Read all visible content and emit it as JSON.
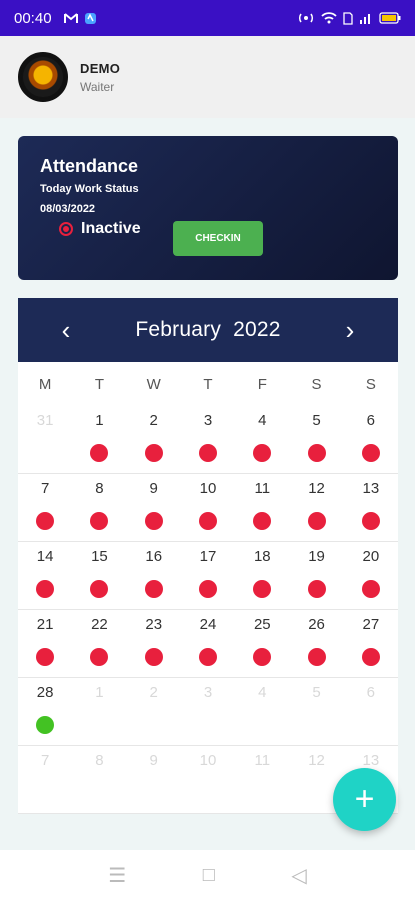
{
  "status_bar": {
    "time": "00:40",
    "left_icons": [
      "gmail-icon",
      "app-icon"
    ],
    "right_icons": [
      "hotspot-icon",
      "wifi-icon",
      "sim-icon",
      "signal-icon",
      "battery-icon"
    ]
  },
  "profile": {
    "name": "DEMO",
    "role": "Waiter"
  },
  "attendance": {
    "title": "Attendance",
    "subtitle": "Today Work Status",
    "date": "08/03/2022",
    "status": "Inactive",
    "checkin_label": "CHECKIN"
  },
  "calendar": {
    "title": "February  2022",
    "prev_icon": "‹",
    "next_icon": "›",
    "weekdays": [
      "M",
      "T",
      "W",
      "T",
      "F",
      "S",
      "S"
    ],
    "weeks": [
      [
        {
          "n": "31",
          "out": true,
          "dot": ""
        },
        {
          "n": "1",
          "out": false,
          "dot": "red"
        },
        {
          "n": "2",
          "out": false,
          "dot": "red"
        },
        {
          "n": "3",
          "out": false,
          "dot": "red"
        },
        {
          "n": "4",
          "out": false,
          "dot": "red"
        },
        {
          "n": "5",
          "out": false,
          "dot": "red"
        },
        {
          "n": "6",
          "out": false,
          "dot": "red"
        }
      ],
      [
        {
          "n": "7",
          "out": false,
          "dot": "red"
        },
        {
          "n": "8",
          "out": false,
          "dot": "red"
        },
        {
          "n": "9",
          "out": false,
          "dot": "red"
        },
        {
          "n": "10",
          "out": false,
          "dot": "red"
        },
        {
          "n": "11",
          "out": false,
          "dot": "red"
        },
        {
          "n": "12",
          "out": false,
          "dot": "red"
        },
        {
          "n": "13",
          "out": false,
          "dot": "red"
        }
      ],
      [
        {
          "n": "14",
          "out": false,
          "dot": "red"
        },
        {
          "n": "15",
          "out": false,
          "dot": "red"
        },
        {
          "n": "16",
          "out": false,
          "dot": "red"
        },
        {
          "n": "17",
          "out": false,
          "dot": "red"
        },
        {
          "n": "18",
          "out": false,
          "dot": "red"
        },
        {
          "n": "19",
          "out": false,
          "dot": "red"
        },
        {
          "n": "20",
          "out": false,
          "dot": "red"
        }
      ],
      [
        {
          "n": "21",
          "out": false,
          "dot": "red"
        },
        {
          "n": "22",
          "out": false,
          "dot": "red"
        },
        {
          "n": "23",
          "out": false,
          "dot": "red"
        },
        {
          "n": "24",
          "out": false,
          "dot": "red"
        },
        {
          "n": "25",
          "out": false,
          "dot": "red"
        },
        {
          "n": "26",
          "out": false,
          "dot": "red"
        },
        {
          "n": "27",
          "out": false,
          "dot": "red"
        }
      ],
      [
        {
          "n": "28",
          "out": false,
          "dot": "green"
        },
        {
          "n": "1",
          "out": true,
          "dot": ""
        },
        {
          "n": "2",
          "out": true,
          "dot": ""
        },
        {
          "n": "3",
          "out": true,
          "dot": ""
        },
        {
          "n": "4",
          "out": true,
          "dot": ""
        },
        {
          "n": "5",
          "out": true,
          "dot": ""
        },
        {
          "n": "6",
          "out": true,
          "dot": ""
        }
      ],
      [
        {
          "n": "7",
          "out": true,
          "dot": ""
        },
        {
          "n": "8",
          "out": true,
          "dot": ""
        },
        {
          "n": "9",
          "out": true,
          "dot": ""
        },
        {
          "n": "10",
          "out": true,
          "dot": ""
        },
        {
          "n": "11",
          "out": true,
          "dot": ""
        },
        {
          "n": "12",
          "out": true,
          "dot": ""
        },
        {
          "n": "13",
          "out": true,
          "dot": ""
        }
      ]
    ]
  },
  "fab": {
    "icon": "+"
  },
  "nav": {
    "menu": "☰",
    "home": "□",
    "back": "◁"
  },
  "colors": {
    "status_bar": "#3a10c4",
    "card_bg": "#1d2a56",
    "checkin": "#4cb050",
    "inactive_red": "#e8203d",
    "present_green": "#43c223",
    "fab": "#1fd3c6"
  }
}
